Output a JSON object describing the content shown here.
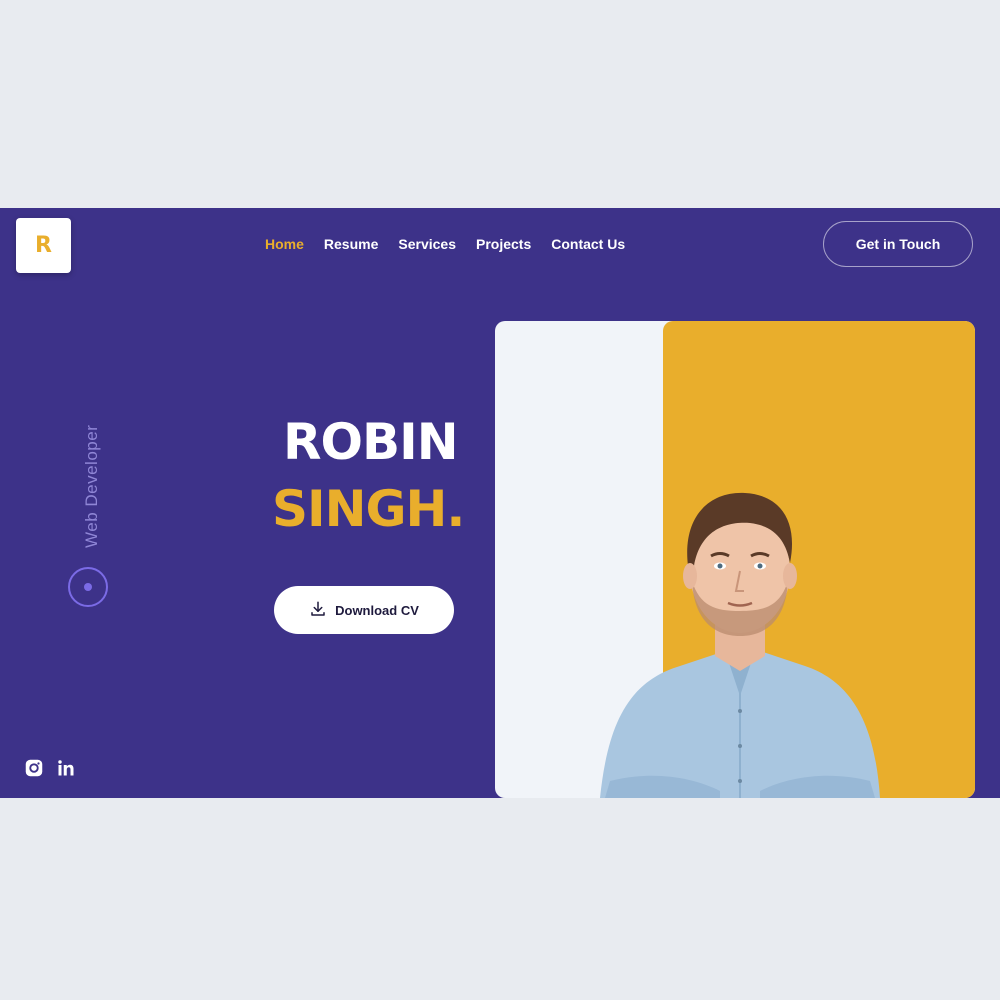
{
  "logo": {
    "letter": "R"
  },
  "nav": {
    "items": [
      {
        "label": "Home",
        "active": true
      },
      {
        "label": "Resume"
      },
      {
        "label": "Services"
      },
      {
        "label": "Projects"
      },
      {
        "label": "Contact Us"
      }
    ]
  },
  "cta": {
    "label": "Get in Touch"
  },
  "hero": {
    "role": "Web Developer",
    "first_name": "ROBIN",
    "last_name": "SINGH.",
    "download_label": "Download CV"
  },
  "socials": {
    "icons": [
      "instagram-icon",
      "linkedin-icon"
    ]
  },
  "colors": {
    "background": "#3d3289",
    "accent": "#e9ae2c",
    "text": "#ffffff",
    "ring": "#7b6be6"
  }
}
